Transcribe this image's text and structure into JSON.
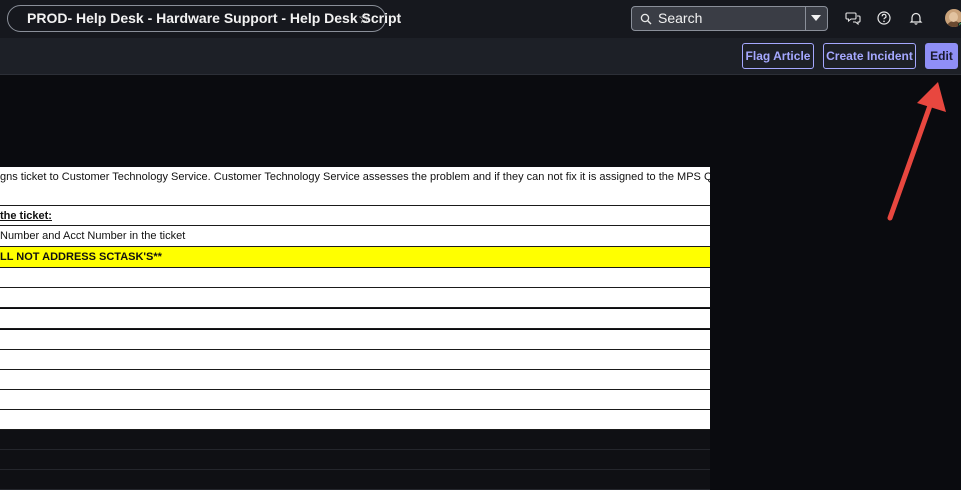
{
  "header": {
    "title": "PROD- Help Desk - Hardware Support - Help Desk Script",
    "star_icon": "☆",
    "search": {
      "label": "Search"
    },
    "icons": [
      "chat-icon",
      "help-icon",
      "bell-icon"
    ]
  },
  "actions": {
    "flag": "Flag Article",
    "incident": "Create Incident",
    "edit": "Edit"
  },
  "document": {
    "intro": "gns ticket to Customer Technology Service.  Customer Technology Service assesses the problem and if they can not fix it is assigned to the MPS Queue",
    "heading": "the ticket:",
    "line": "Number and Acct Number in the ticket",
    "highlight": "LL NOT ADDRESS SCTASK'S**",
    "highlight_color": "#ffff00"
  },
  "colors": {
    "accent": "#a5a8ff",
    "annotation_arrow": "#e8473f"
  }
}
